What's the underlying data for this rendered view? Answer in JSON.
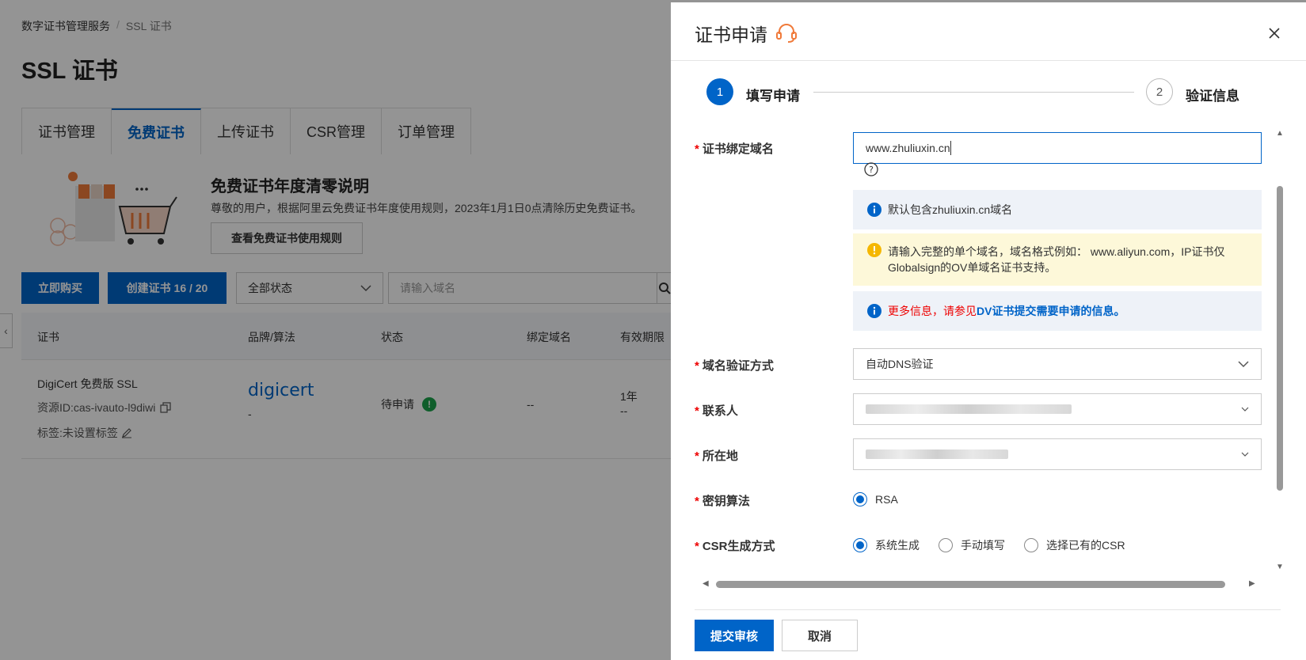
{
  "background": {
    "breadcrumb": {
      "root": "数字证书管理服务",
      "sep": "/",
      "current": "SSL 证书"
    },
    "page_title": "SSL 证书",
    "tabs": [
      {
        "label": "证书管理"
      },
      {
        "label": "免费证书"
      },
      {
        "label": "上传证书"
      },
      {
        "label": "CSR管理"
      },
      {
        "label": "订单管理"
      }
    ],
    "notice": {
      "title": "免费证书年度清零说明",
      "text": "尊敬的用户，根据阿里云免费证书年度使用规则，2023年1月1日0点清除历史免费证书。",
      "button": "查看免费证书使用规则"
    },
    "toolbar": {
      "buy": "立即购买",
      "create": "创建证书 16 / 20",
      "status_select": "全部状态",
      "domain_placeholder": "请输入域名"
    },
    "table": {
      "headers": [
        "证书",
        "品牌/算法",
        "状态",
        "绑定域名",
        "有效期限"
      ],
      "row": {
        "name": "DigiCert 免费版 SSL",
        "resource_id": "资源ID:cas-ivauto-l9diwi",
        "tag": "标签:未设置标签",
        "brand": "digicert",
        "brand_sub": "-",
        "status": "待申请",
        "domain": "--",
        "validity": "1年",
        "validity_sub": "--"
      }
    }
  },
  "drawer": {
    "title": "证书申请",
    "steps": [
      {
        "num": "1",
        "label": "填写申请"
      },
      {
        "num": "2",
        "label": "验证信息"
      }
    ],
    "form": {
      "domain": {
        "label": "证书绑定域名",
        "value": "www.zhuliuxin.cn"
      },
      "alerts": {
        "info1": "默认包含zhuliuxin.cn域名",
        "warn": "请输入完整的单个域名，域名格式例如： www.aliyun.com，IP证书仅Globalsign的OV单域名证书支持。",
        "info2_red": "更多信息，请参见",
        "info2_link": "DV证书提交需要申请的信息。"
      },
      "verify": {
        "label": "域名验证方式",
        "value": "自动DNS验证"
      },
      "contact": {
        "label": "联系人"
      },
      "location": {
        "label": "所在地"
      },
      "key_algo": {
        "label": "密钥算法",
        "option": "RSA"
      },
      "csr": {
        "label": "CSR生成方式",
        "options": [
          "系统生成",
          "手动填写",
          "选择已有的CSR"
        ]
      }
    },
    "submit": "提交审核",
    "cancel": "取消"
  }
}
